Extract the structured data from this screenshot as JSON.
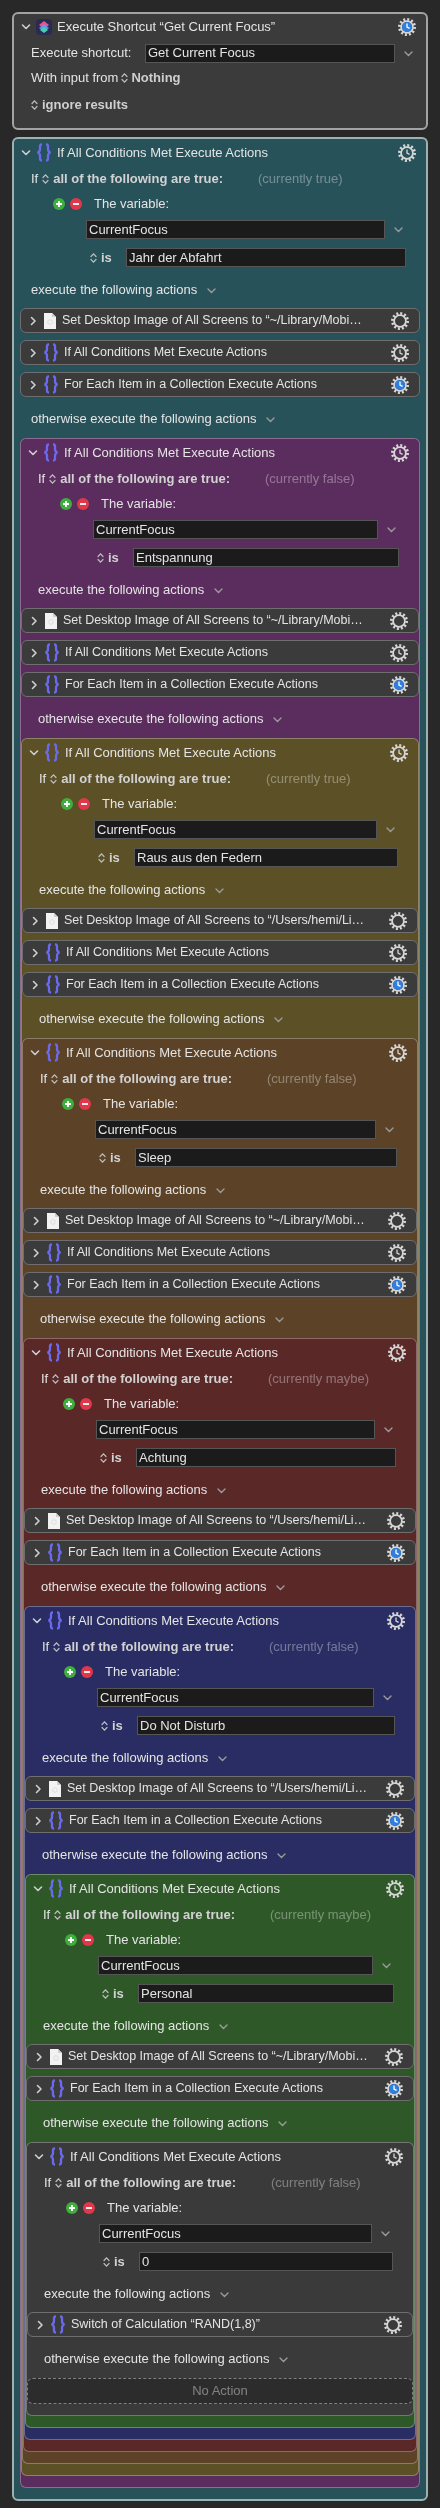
{
  "shortcut_action": {
    "title": "Execute Shortcut “Get Current Focus”",
    "expanded": true,
    "shortcut_label": "Execute shortcut:",
    "shortcut_value": "Get Current Focus",
    "input_label": "With input from",
    "input_value": "Nothing",
    "results": "ignore results"
  },
  "if_block": {
    "title": "If All Conditions Met Execute Actions",
    "color": "#28525a",
    "expanded": true,
    "if_label": "If",
    "mode": "all of the following are true:",
    "status": "(currently true)",
    "variable_label": "The variable:",
    "variable": "CurrentFocus",
    "operator": "is",
    "value": "Jahr der Abfahrt",
    "then_label": "execute the following actions",
    "actions": [
      {
        "kind": "set_desktop",
        "title": "Set Desktop Image of All Screens to “~/Library/Mobi…",
        "expanded": false
      },
      {
        "kind": "if",
        "title": "If All Conditions Met Execute Actions",
        "expanded": false
      },
      {
        "kind": "for_each",
        "title": "For Each Item in a Collection Execute Actions",
        "expanded": false
      }
    ],
    "else_label": "otherwise execute the following actions",
    "else_block": {
      "title": "If All Conditions Met Execute Actions",
      "color": "#5b2c5e",
      "expanded": true,
      "if_label": "If",
      "mode": "all of the following are true:",
      "status": "(currently false)",
      "variable_label": "The variable:",
      "variable": "CurrentFocus",
      "operator": "is",
      "value": "Entspannung",
      "then_label": "execute the following actions",
      "actions": [
        {
          "kind": "set_desktop",
          "title": "Set Desktop Image of All Screens to “~/Library/Mobi…",
          "expanded": false
        },
        {
          "kind": "if",
          "title": "If All Conditions Met Execute Actions",
          "expanded": false
        },
        {
          "kind": "for_each",
          "title": "For Each Item in a Collection Execute Actions",
          "expanded": false
        }
      ],
      "else_label": "otherwise execute the following actions",
      "else_block": {
        "title": "If All Conditions Met Execute Actions",
        "color": "#5c5027",
        "expanded": true,
        "if_label": "If",
        "mode": "all of the following are true:",
        "status": "(currently true)",
        "variable_label": "The variable:",
        "variable": "CurrentFocus",
        "operator": "is",
        "value": "Raus aus den Federn",
        "then_label": "execute the following actions",
        "actions": [
          {
            "kind": "set_desktop",
            "title": "Set Desktop Image of All Screens to “/Users/hemi/Li…",
            "expanded": false
          },
          {
            "kind": "if",
            "title": "If All Conditions Met Execute Actions",
            "expanded": false
          },
          {
            "kind": "for_each",
            "title": "For Each Item in a Collection Execute Actions",
            "expanded": false
          }
        ],
        "else_label": "otherwise execute the following actions",
        "else_block": {
          "title": "If All Conditions Met Execute Actions",
          "color": "#5c4226",
          "expanded": true,
          "if_label": "If",
          "mode": "all of the following are true:",
          "status": "(currently false)",
          "variable_label": "The variable:",
          "variable": "CurrentFocus",
          "operator": "is",
          "value": "Sleep",
          "then_label": "execute the following actions",
          "actions": [
            {
              "kind": "set_desktop",
              "title": "Set Desktop Image of All Screens to “~/Library/Mobi…",
              "expanded": false
            },
            {
              "kind": "if",
              "title": "If All Conditions Met Execute Actions",
              "expanded": false
            },
            {
              "kind": "for_each",
              "title": "For Each Item in a Collection Execute Actions",
              "expanded": false
            }
          ],
          "else_label": "otherwise execute the following actions",
          "else_block": {
            "title": "If All Conditions Met Execute Actions",
            "color": "#5b2828",
            "expanded": true,
            "if_label": "If",
            "mode": "all of the following are true:",
            "status": "(currently maybe)",
            "variable_label": "The variable:",
            "variable": "CurrentFocus",
            "operator": "is",
            "value": "Achtung",
            "then_label": "execute the following actions",
            "actions": [
              {
                "kind": "set_desktop",
                "title": "Set Desktop Image of All Screens to “/Users/hemi/Li…",
                "expanded": false
              },
              {
                "kind": "for_each",
                "title": "For Each Item in a Collection Execute Actions",
                "expanded": false
              }
            ],
            "else_label": "otherwise execute the following actions",
            "else_block": {
              "title": "If All Conditions Met Execute Actions",
              "color": "#2a2d63",
              "expanded": true,
              "if_label": "If",
              "mode": "all of the following are true:",
              "status": "(currently false)",
              "variable_label": "The variable:",
              "variable": "CurrentFocus",
              "operator": "is",
              "value": "Do Not Disturb",
              "then_label": "execute the following actions",
              "actions": [
                {
                  "kind": "set_desktop",
                  "title": "Set Desktop Image of All Screens to “/Users/hemi/Li…",
                  "expanded": false
                },
                {
                  "kind": "for_each",
                  "title": "For Each Item in a Collection Execute Actions",
                  "expanded": false
                }
              ],
              "else_label": "otherwise execute the following actions",
              "else_block": {
                "title": "If All Conditions Met Execute Actions",
                "color": "#2f5829",
                "expanded": true,
                "if_label": "If",
                "mode": "all of the following are true:",
                "status": "(currently maybe)",
                "variable_label": "The variable:",
                "variable": "CurrentFocus",
                "operator": "is",
                "value": "Personal",
                "then_label": "execute the following actions",
                "actions": [
                  {
                    "kind": "set_desktop",
                    "title": "Set Desktop Image of All Screens to “~/Library/Mobi…",
                    "expanded": false
                  },
                  {
                    "kind": "for_each",
                    "title": "For Each Item in a Collection Execute Actions",
                    "expanded": false
                  }
                ],
                "else_label": "otherwise execute the following actions",
                "else_block": {
                  "title": "If All Conditions Met Execute Actions",
                  "color": "#3a3a3a",
                  "expanded": true,
                  "if_label": "If",
                  "mode": "all of the following are true:",
                  "status": "(currently false)",
                  "variable_label": "The variable:",
                  "variable": "CurrentFocus",
                  "operator": "is",
                  "value": "0",
                  "then_label": "execute the following actions",
                  "actions": [
                    {
                      "kind": "switch",
                      "title": "Switch of Calculation “RAND(1,8)”",
                      "expanded": false
                    }
                  ],
                  "else_label": "otherwise execute the following actions",
                  "else_empty": "No Action"
                }
              }
            }
          }
        }
      }
    }
  }
}
